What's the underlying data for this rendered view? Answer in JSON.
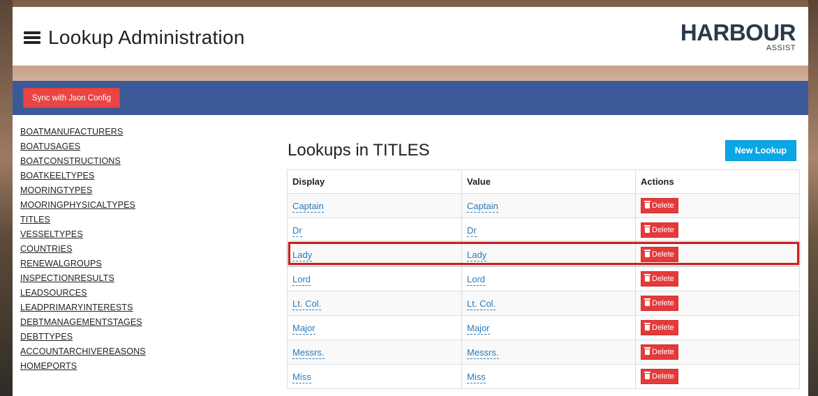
{
  "header": {
    "title": "Lookup Administration",
    "logo_main": "HARBOUR",
    "logo_sub": "ASSIST"
  },
  "toolbar": {
    "sync_label": "Sync with Json Config"
  },
  "sidebar": {
    "items": [
      "BOATMANUFACTURERS",
      "BOATUSAGES",
      "BOATCONSTRUCTIONS",
      "BOATKEELTYPES",
      "MOORINGTYPES",
      "MOORINGPHYSICALTYPES",
      "TITLES",
      "VESSELTYPES",
      "COUNTRIES",
      "RENEWALGROUPS",
      "INSPECTIONRESULTS",
      "LEADSOURCES",
      "LEADPRIMARYINTERESTS",
      "DEBTMANAGEMENTSTAGES",
      "DEBTTYPES",
      "ACCOUNTARCHIVEREASONS",
      "HOMEPORTS"
    ]
  },
  "main": {
    "section_title": "Lookups in TITLES",
    "new_label": "New Lookup",
    "columns": [
      "Display",
      "Value",
      "Actions"
    ],
    "delete_label": "Delete",
    "rows": [
      {
        "display": "Captain",
        "value": "Captain"
      },
      {
        "display": "Dr",
        "value": "Dr"
      },
      {
        "display": "Lady",
        "value": "Lady"
      },
      {
        "display": "Lord",
        "value": "Lord"
      },
      {
        "display": "Lt. Col.",
        "value": "Lt. Col."
      },
      {
        "display": "Major",
        "value": "Major"
      },
      {
        "display": "Messrs.",
        "value": "Messrs."
      },
      {
        "display": "Miss",
        "value": "Miss"
      }
    ],
    "highlighted_row": "Lady"
  },
  "colors": {
    "toolbar_bg": "#3b5998",
    "danger": "#e53a3a",
    "primary": "#0aa7e6",
    "link": "#2a7ab8",
    "highlight": "#cc1f1f"
  }
}
